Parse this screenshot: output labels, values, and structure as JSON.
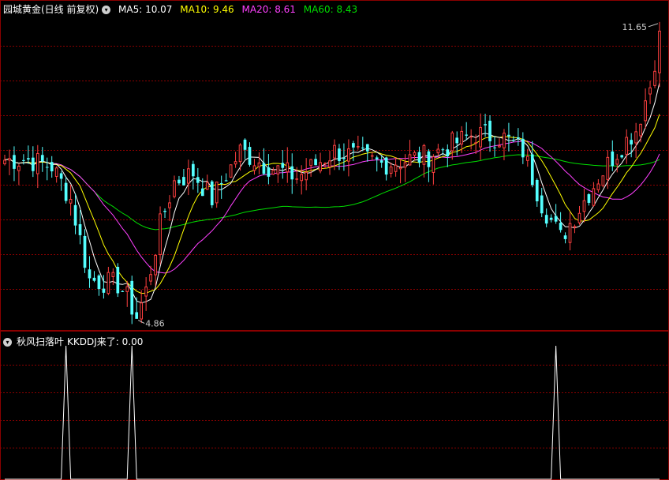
{
  "upper": {
    "title": "园城黄金(日线 前复权)",
    "indicators": [
      {
        "label": "MA5: 10.07",
        "color": "#ffffff"
      },
      {
        "label": "MA10: 9.46",
        "color": "#ffff00"
      },
      {
        "label": "MA20: 8.61",
        "color": "#ff40ff"
      },
      {
        "label": "MA60: 8.43",
        "color": "#00e000"
      }
    ],
    "high_label": "11.65",
    "low_label": "4.86"
  },
  "lower": {
    "title": "秋风扫落叶",
    "indicator": "KKDDJ来了: 0.00"
  },
  "colors": {
    "up": "#ff4040",
    "down": "#54ffff",
    "grid": "#8b0000",
    "ma5": "#ffffff",
    "ma10": "#ffff00",
    "ma20": "#ff40ff",
    "ma60": "#00e000"
  },
  "chart_data": [
    {
      "type": "candlestick",
      "series_names": [
        "MA5",
        "MA10",
        "MA20",
        "MA60"
      ],
      "ylim": [
        4.6,
        11.9
      ],
      "candles": 140,
      "anchors": [
        [
          0,
          8.5
        ],
        [
          5,
          8.5
        ],
        [
          10,
          8.35
        ],
        [
          14,
          7.6
        ],
        [
          18,
          5.75
        ],
        [
          24,
          5.65
        ],
        [
          26,
          5.35
        ],
        [
          28,
          4.9
        ],
        [
          30,
          5.5
        ],
        [
          33,
          7.0
        ],
        [
          36,
          8.0
        ],
        [
          40,
          8.2
        ],
        [
          44,
          7.6
        ],
        [
          50,
          8.7
        ],
        [
          55,
          8.4
        ],
        [
          62,
          8.1
        ],
        [
          70,
          8.7
        ],
        [
          80,
          8.4
        ],
        [
          90,
          8.6
        ],
        [
          100,
          9.1
        ],
        [
          106,
          9.0
        ],
        [
          110,
          8.7
        ],
        [
          114,
          7.5
        ],
        [
          118,
          6.7
        ],
        [
          122,
          7.4
        ],
        [
          126,
          8.1
        ],
        [
          130,
          8.7
        ],
        [
          134,
          9.2
        ],
        [
          137,
          10.2
        ],
        [
          139,
          11.4
        ]
      ],
      "marked_high": 11.65,
      "marked_low": 4.86
    },
    {
      "type": "line",
      "series_names": [
        "KKDDJ来了"
      ],
      "ylim": [
        0,
        1
      ],
      "spikes_at_index": [
        13,
        27,
        117
      ],
      "last_value": 0.0
    }
  ]
}
